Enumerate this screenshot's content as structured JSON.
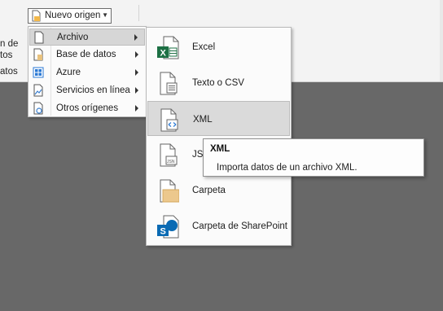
{
  "ribbon": {
    "new_source_label": "Nuevo origen",
    "partial_left_1": "n de",
    "partial_left_2": "tos",
    "partial_left_3": "atos"
  },
  "menu": {
    "items": [
      {
        "label": "Archivo",
        "icon": "file-icon"
      },
      {
        "label": "Base de datos",
        "icon": "database-icon"
      },
      {
        "label": "Azure",
        "icon": "azure-icon"
      },
      {
        "label": "Servicios en línea",
        "icon": "online-services-icon"
      },
      {
        "label": "Otros orígenes",
        "icon": "other-sources-icon"
      }
    ]
  },
  "submenu": {
    "items": [
      {
        "label": "Excel",
        "icon": "excel-file-icon"
      },
      {
        "label": "Texto o CSV",
        "icon": "text-csv-icon"
      },
      {
        "label": "XML",
        "icon": "xml-file-icon"
      },
      {
        "label": "JSON",
        "icon": "json-file-icon"
      },
      {
        "label": "Carpeta",
        "icon": "folder-icon"
      },
      {
        "label": "Carpeta de SharePoint",
        "icon": "sharepoint-folder-icon"
      }
    ]
  },
  "tooltip": {
    "title": "XML",
    "description": "Importa datos de un archivo XML."
  },
  "colors": {
    "excel_green": "#1d7044",
    "sharepoint_blue": "#0a6ab3",
    "folder_tan": "#ecc88d",
    "azure_blue": "#2b79d4"
  }
}
